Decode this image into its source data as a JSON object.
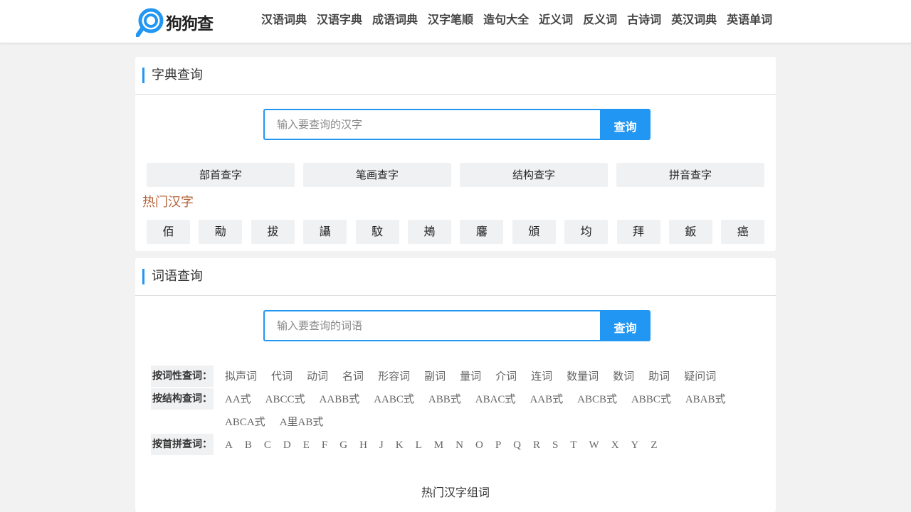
{
  "brand": {
    "name": "狗狗查",
    "accent": "#2196f3"
  },
  "nav": [
    "汉语词典",
    "汉语字典",
    "成语词典",
    "汉字笔顺",
    "造句大全",
    "近义词",
    "反义词",
    "古诗词",
    "英汉词典",
    "英语单词"
  ],
  "dict": {
    "title": "字典查询",
    "placeholder": "输入要查询的汉字",
    "button": "查询",
    "modes": [
      "部首查字",
      "笔画查字",
      "结构查字",
      "拼音查字"
    ],
    "hot_title": "热门汉字",
    "hot_chars": [
      "佰",
      "㔝",
      "拔",
      "讘",
      "馼",
      "鴂",
      "麘",
      "頒",
      "均",
      "拜",
      "鈑",
      "癌"
    ]
  },
  "words": {
    "title": "词语查询",
    "placeholder": "输入要查询的词语",
    "button": "查询",
    "by_pos_label": "按词性查词：",
    "by_pos": [
      "拟声词",
      "代词",
      "动词",
      "名词",
      "形容词",
      "副词",
      "量词",
      "介词",
      "连词",
      "数量词",
      "数词",
      "助词",
      "疑问词"
    ],
    "by_struct_label": "按结构查词：",
    "by_struct": [
      "AA式",
      "ABCC式",
      "AABB式",
      "AABC式",
      "ABB式",
      "ABAC式",
      "AAB式",
      "ABCB式",
      "ABBC式",
      "ABAB式",
      "ABCA式",
      "A里AB式"
    ],
    "by_initial_label": "按首拼查词：",
    "by_initial": [
      "A",
      "B",
      "C",
      "D",
      "E",
      "F",
      "G",
      "H",
      "J",
      "K",
      "L",
      "M",
      "N",
      "O",
      "P",
      "Q",
      "R",
      "S",
      "T",
      "W",
      "X",
      "Y",
      "Z"
    ],
    "hot_words": "热门汉字组词"
  }
}
